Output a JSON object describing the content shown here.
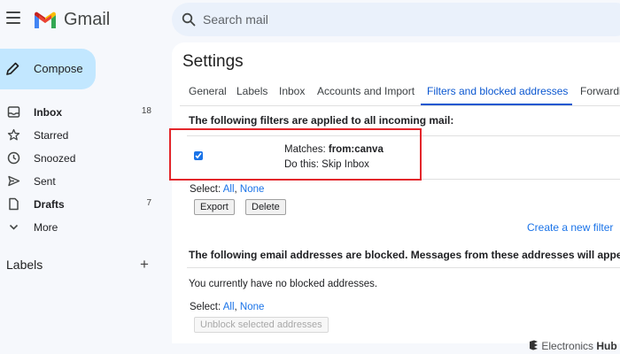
{
  "header": {
    "brand": "Gmail",
    "search_placeholder": "Search mail"
  },
  "sidebar": {
    "compose_label": "Compose",
    "items": [
      {
        "label": "Inbox",
        "count": "18"
      },
      {
        "label": "Starred",
        "count": ""
      },
      {
        "label": "Snoozed",
        "count": ""
      },
      {
        "label": "Sent",
        "count": ""
      },
      {
        "label": "Drafts",
        "count": "7"
      },
      {
        "label": "More",
        "count": ""
      }
    ],
    "labels_title": "Labels",
    "labels_add": "+"
  },
  "settings": {
    "title": "Settings",
    "tabs": [
      "General",
      "Labels",
      "Inbox",
      "Accounts and Import",
      "Filters and blocked addresses",
      "Forwarding"
    ],
    "active_tab": "Filters and blocked addresses",
    "filters_heading": "The following filters are applied to all incoming mail:",
    "filter": {
      "matches_prefix": "Matches: ",
      "matches_value": "from:canva",
      "action": "Do this: Skip Inbox",
      "checked": true
    },
    "select_label": "Select: ",
    "select_all": "All",
    "select_sep": ", ",
    "select_none": "None",
    "export_label": "Export",
    "delete_label": "Delete",
    "create_filter_link": "Create a new filter",
    "blocked_heading": "The following email addresses are blocked. Messages from these addresses will appear i",
    "blocked_empty": "You currently have no blocked addresses.",
    "unblock_label": "Unblock selected addresses"
  },
  "watermark": {
    "brand_first": "Electronics",
    "brand_second": "Hub"
  },
  "colors": {
    "accent": "#0b57d0",
    "compose_bg": "#c2e7ff",
    "highlight": "#e3262b"
  }
}
